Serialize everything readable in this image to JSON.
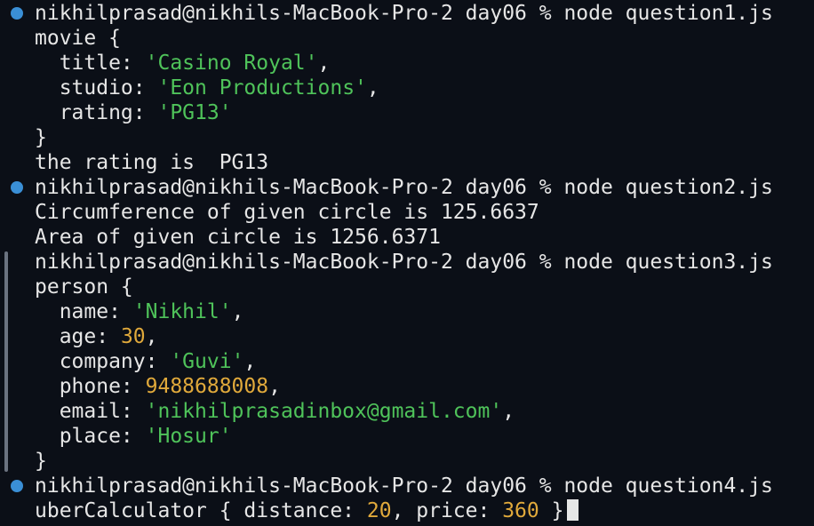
{
  "terminal": {
    "prompt": "nikhilprasad@nikhils-MacBook-Pro-2 day06 % ",
    "commands": [
      "node question1.js",
      "node question2.js",
      "node question3.js",
      "node question4.js"
    ],
    "colors": {
      "background": "#0b0f17",
      "text": "#e6e6e6",
      "string": "#4fc35a",
      "number": "#e0a93b",
      "prompt_marker": "#3a8fd6"
    },
    "output1": {
      "open": "movie {",
      "title_key": "  title: ",
      "title_val": "'Casino Royal'",
      "studio_key": "  studio: ",
      "studio_val": "'Eon Productions'",
      "rating_key": "  rating: ",
      "rating_val": "'PG13'",
      "close": "}",
      "rating_line": "the rating is  PG13"
    },
    "output2": {
      "circumference": "Circumference of given circle is 125.6637",
      "area": "Area of given circle is 1256.6371"
    },
    "output3": {
      "open": "person {",
      "name_key": "  name: ",
      "name_val": "'Nikhil'",
      "age_key": "  age: ",
      "age_val": "30",
      "company_key": "  company: ",
      "company_val": "'Guvi'",
      "phone_key": "  phone: ",
      "phone_val": "9488688008",
      "email_key": "  email: ",
      "email_val": "'nikhilprasadinbox@gmail.com'",
      "place_key": "  place: ",
      "place_val": "'Hosur'",
      "close": "}"
    },
    "output4": {
      "prefix": "uberCalculator { distance: ",
      "distance": "20",
      "mid": ", price: ",
      "price": "360",
      "suffix": " }"
    },
    "comma": ","
  }
}
